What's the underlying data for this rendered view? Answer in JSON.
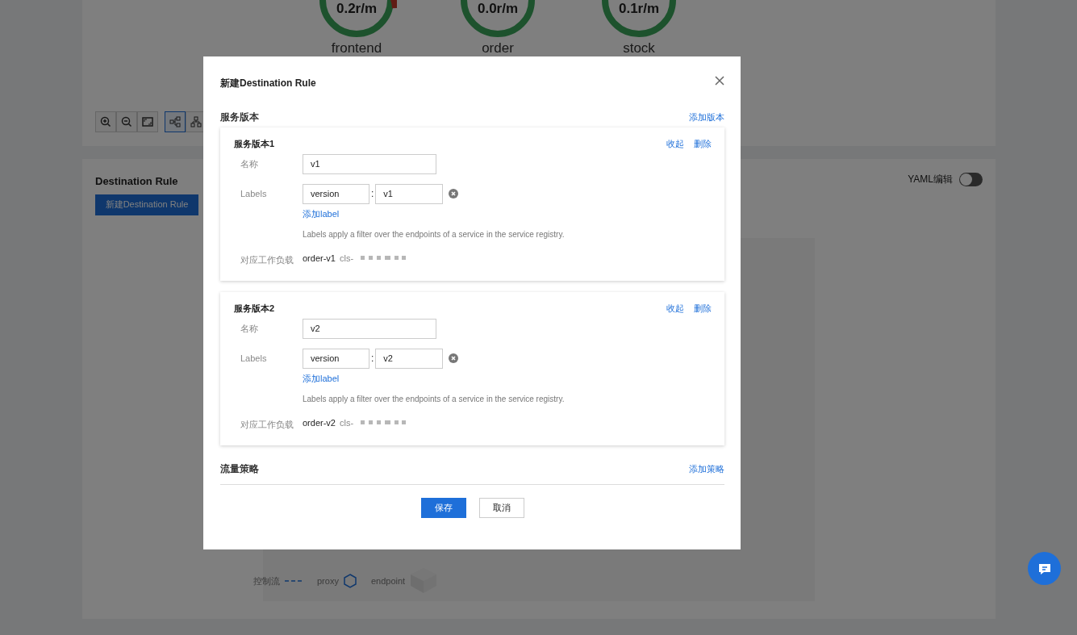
{
  "topology": {
    "nodes": [
      {
        "rate": "0.2r/m",
        "name": "frontend",
        "kind": "warn"
      },
      {
        "rate": "0.0r/m",
        "name": "order",
        "kind": "ok"
      },
      {
        "rate": "0.1r/m",
        "name": "stock",
        "kind": "ok"
      }
    ],
    "tools": [
      {
        "selected": false
      },
      {
        "selected": false
      },
      {
        "selected": false
      },
      {
        "selected": true
      },
      {
        "selected": false
      }
    ]
  },
  "destination_rule": {
    "title": "Destination Rule",
    "create_button": "新建Destination Rule",
    "yaml_toggle": {
      "label": "YAML编辑",
      "on": false
    },
    "legend": [
      {
        "label": "控制流",
        "kind": "line"
      },
      {
        "label": "proxy",
        "kind": "hex"
      },
      {
        "label": "endpoint",
        "kind": "cube"
      }
    ]
  },
  "modal": {
    "title": "新建Destination Rule",
    "section": "服务版本",
    "add_version": "添加版本",
    "versions": [
      {
        "title": "服务版本1",
        "actions": [
          "收起",
          "删除"
        ],
        "name_label": "名称",
        "name_value": "v1",
        "labels_label": "Labels",
        "labels": [
          {
            "key": "version",
            "separator": ":",
            "value": "v1"
          }
        ],
        "add_label": "添加label",
        "hint": "Labels apply a filter over the endpoints of a service in the service registry.",
        "workload_label": "对应工作负载",
        "workload": "order-v1",
        "cluster": "cls-"
      },
      {
        "title": "服务版本2",
        "actions": [
          "收起",
          "删除"
        ],
        "name_label": "名称",
        "name_value": "v2",
        "labels_label": "Labels",
        "labels": [
          {
            "key": "version",
            "separator": ":",
            "value": "v2"
          }
        ],
        "add_label": "添加label",
        "hint": "Labels apply a filter over the endpoints of a service in the service registry.",
        "workload_label": "对应工作负载",
        "workload": "order-v2",
        "cluster": "cls-"
      }
    ],
    "traffic_section": "流量策略",
    "add_policy": "添加策略",
    "buttons": [
      {
        "label": "保存",
        "kind": "primary"
      },
      {
        "label": "取消",
        "kind": "default"
      }
    ]
  }
}
